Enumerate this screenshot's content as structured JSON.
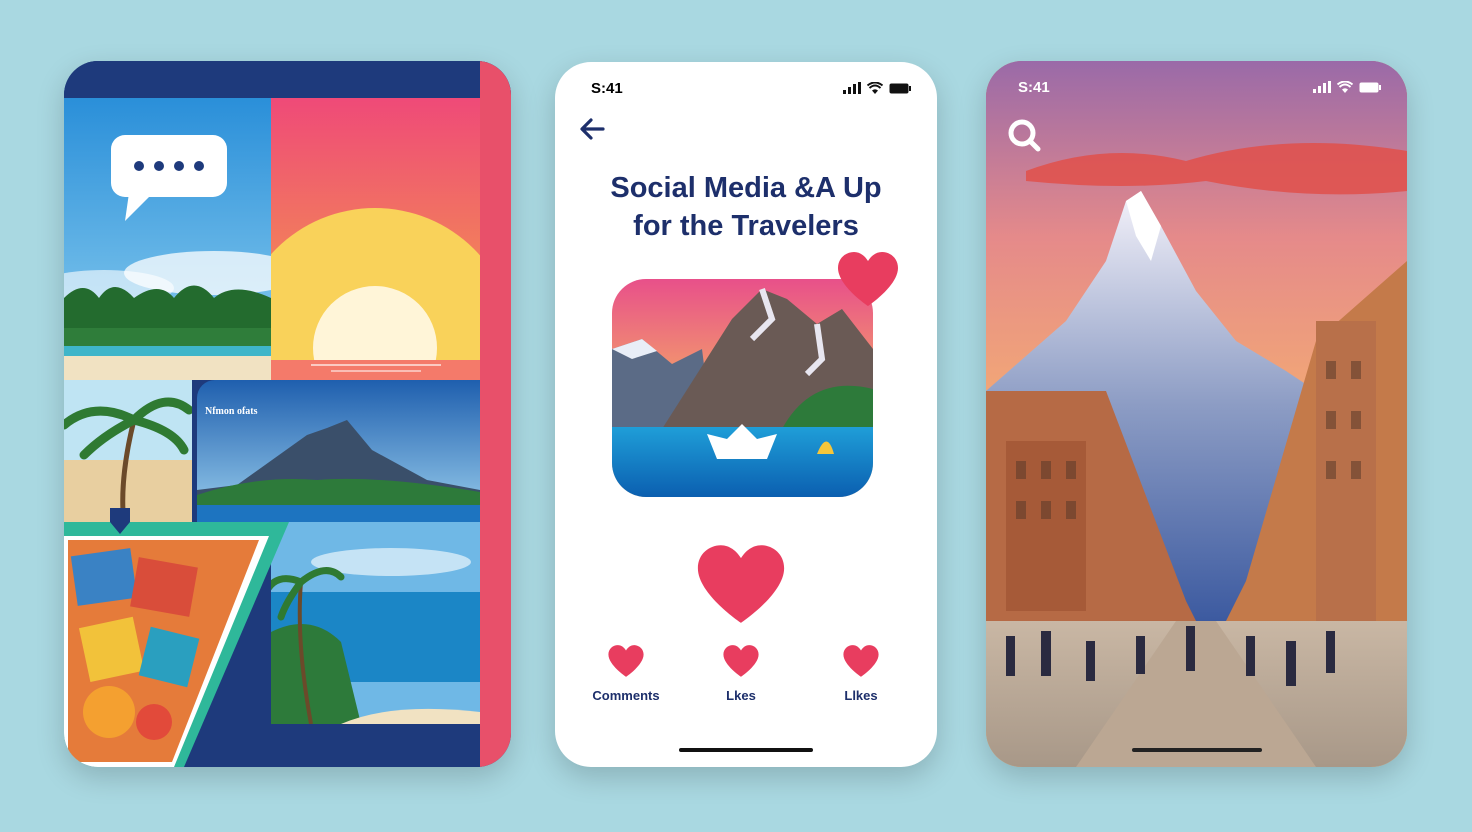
{
  "middle_screen": {
    "status_time": "S:41",
    "title_line1": "Social Media &A Up",
    "title_line2": "for the Travelers",
    "stats": [
      {
        "label": "Comments"
      },
      {
        "label": "Lkes"
      },
      {
        "label": "Llkes"
      }
    ]
  },
  "right_screen": {
    "status_time": "S:41"
  },
  "left_screen": {
    "island_caption": "Nfmon ofats"
  },
  "colors": {
    "background": "#a9d8e1",
    "navy": "#1d2f6b",
    "heart": "#e83d5f",
    "accent_pink": "#e8506a"
  },
  "icons": [
    "chat-bubble-icon",
    "back-arrow-icon",
    "heart-icon",
    "search-icon",
    "signal-icon",
    "wifi-icon",
    "battery-icon"
  ]
}
